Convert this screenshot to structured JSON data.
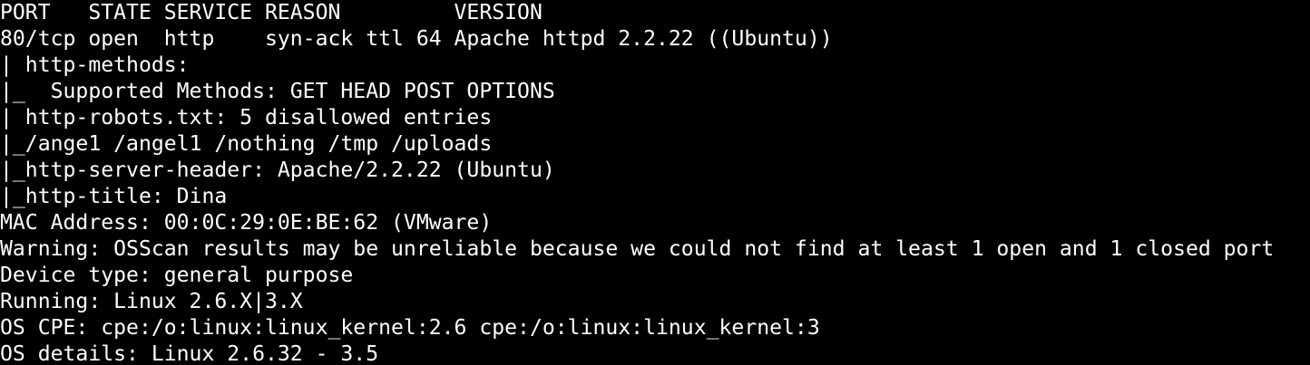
{
  "terminal": {
    "background": "#000000",
    "foreground": "#ffffff",
    "lines": [
      "PORT   STATE SERVICE REASON         VERSION",
      "80/tcp open  http    syn-ack ttl 64 Apache httpd 2.2.22 ((Ubuntu))",
      "| http-methods: ",
      "|_  Supported Methods: GET HEAD POST OPTIONS",
      "| http-robots.txt: 5 disallowed entries ",
      "|_/ange1 /angel1 /nothing /tmp /uploads",
      "|_http-server-header: Apache/2.2.22 (Ubuntu)",
      "|_http-title: Dina",
      "MAC Address: 00:0C:29:0E:BE:62 (VMware)",
      "Warning: OSScan results may be unreliable because we could not find at least 1 open and 1 closed port",
      "Device type: general purpose",
      "Running: Linux 2.6.X|3.X",
      "OS CPE: cpe:/o:linux:linux_kernel:2.6 cpe:/o:linux:linux_kernel:3",
      "OS details: Linux 2.6.32 - 3.5"
    ]
  }
}
